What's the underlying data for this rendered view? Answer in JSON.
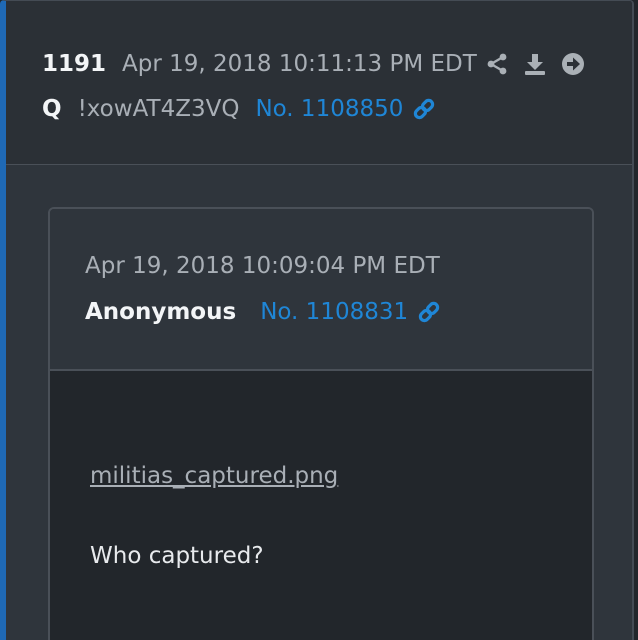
{
  "post": {
    "number": "1191",
    "date": "Apr 19, 2018 10:11:13 PM EDT",
    "author": "Q",
    "tripcode": "!xowAT4Z3VQ",
    "post_link": "No. 1108850",
    "icons": [
      "share-icon",
      "download-icon",
      "arrow-right-circle-icon",
      "link-icon"
    ]
  },
  "quoted": {
    "date": "Apr 19, 2018 10:09:04 PM EDT",
    "author": "Anonymous",
    "post_link": "No. 1108831",
    "file_name": "militias_captured.png",
    "text": "Who captured?"
  },
  "colors": {
    "accent_bar": "#1f69b5",
    "link": "#1f86d6",
    "background": "#22262b",
    "card": "#2f353c"
  }
}
